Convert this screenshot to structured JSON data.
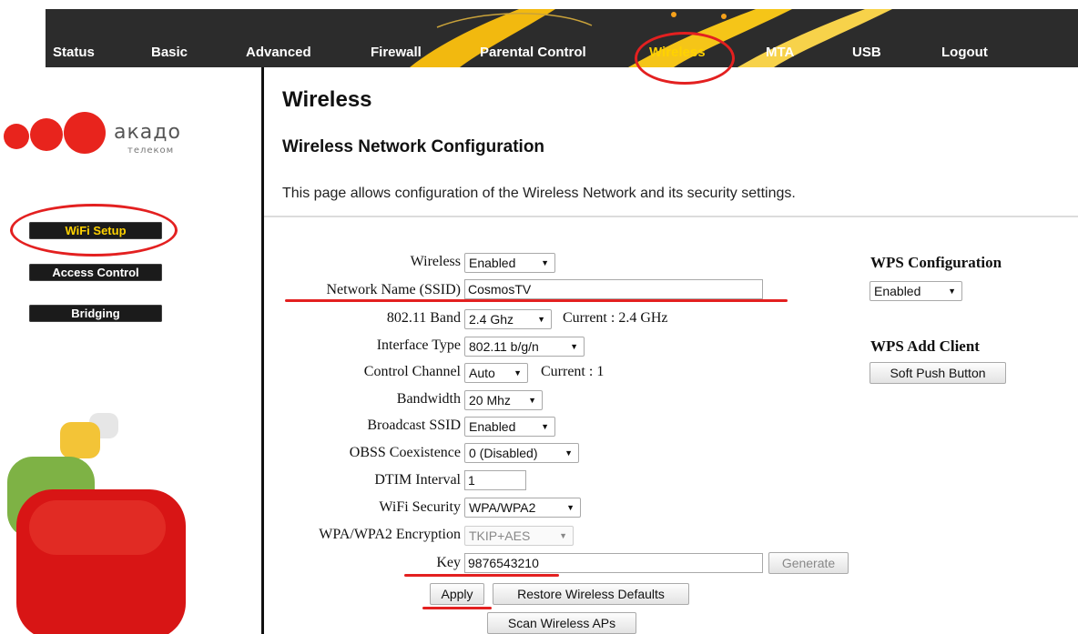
{
  "nav": {
    "items": [
      "Status",
      "Basic",
      "Advanced",
      "Firewall",
      "Parental Control",
      "Wireless",
      "MTA",
      "USB",
      "Logout"
    ],
    "active": "Wireless"
  },
  "brand": {
    "name": "акадо",
    "sub": "телеком"
  },
  "sidebar": {
    "items": [
      "WiFi Setup",
      "Access Control",
      "Bridging"
    ],
    "active": "WiFi Setup"
  },
  "page": {
    "title": "Wireless",
    "subtitle": "Wireless Network Configuration",
    "description": "This page allows configuration of the Wireless Network and its security settings."
  },
  "form": {
    "wireless": {
      "label": "Wireless",
      "value": "Enabled"
    },
    "ssid": {
      "label": "Network Name (SSID)",
      "value": "CosmosTV"
    },
    "band": {
      "label": "802.11 Band",
      "value": "2.4 Ghz",
      "current": "Current :  2.4 GHz"
    },
    "iface": {
      "label": "Interface Type",
      "value": "802.11 b/g/n"
    },
    "channel": {
      "label": "Control Channel",
      "value": "Auto",
      "current": "Current :  1"
    },
    "bandwidth": {
      "label": "Bandwidth",
      "value": "20 Mhz"
    },
    "broadcast": {
      "label": "Broadcast SSID",
      "value": "Enabled"
    },
    "obss": {
      "label": "OBSS Coexistence",
      "value": "0 (Disabled)"
    },
    "dtim": {
      "label": "DTIM Interval",
      "value": "1"
    },
    "security": {
      "label": "WiFi Security",
      "value": "WPA/WPA2"
    },
    "encryption": {
      "label": "WPA/WPA2 Encryption",
      "value": "TKIP+AES"
    },
    "key": {
      "label": "Key",
      "value": "9876543210"
    },
    "generate_label": "Generate",
    "apply_label": "Apply",
    "restore_label": "Restore Wireless Defaults",
    "scan_label": "Scan Wireless APs"
  },
  "wps": {
    "config_title": "WPS Configuration",
    "config_value": "Enabled",
    "add_client_title": "WPS Add Client",
    "push_button_label": "Soft Push Button"
  },
  "colors": {
    "annotation": "#e32020",
    "nav_active": "#ffd200",
    "brand_red": "#e8241d"
  }
}
